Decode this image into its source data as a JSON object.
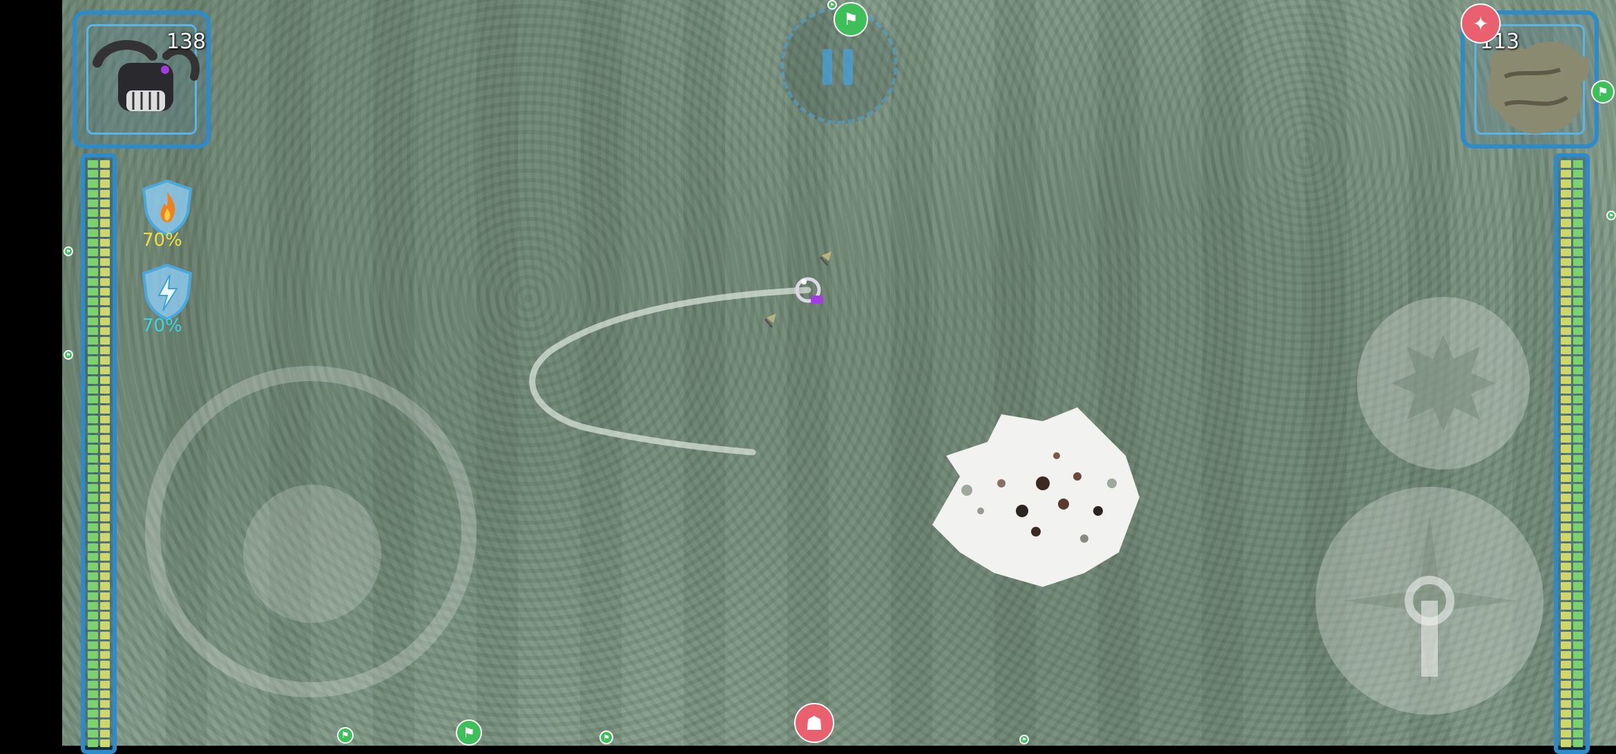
{
  "player": {
    "count": "138",
    "icon": "mech-hover-tank-icon",
    "fire_resist": "70%",
    "shock_resist": "70%",
    "health_fraction": 1.0
  },
  "enemy": {
    "count": "113",
    "icon": "rock-beast-icon",
    "health_fraction": 1.0
  },
  "hud": {
    "pause_icon": "pause-icon",
    "fire_icon": "fire-icon",
    "lightning_icon": "lightning-icon"
  },
  "markers": {
    "flag_icon": "flag-icon",
    "enemy_icon": "horned-beast-icon",
    "wolf_icon": "wolf-icon"
  },
  "colors": {
    "frame_blue": "#2d8bc9",
    "health_green": "#7dd36b",
    "health_yellow": "#cfd66a",
    "fire_pct": "#f2e03a",
    "shock_pct": "#37d6e8",
    "flag_green": "#3fbf5a",
    "enemy_red": "#e9616e"
  }
}
